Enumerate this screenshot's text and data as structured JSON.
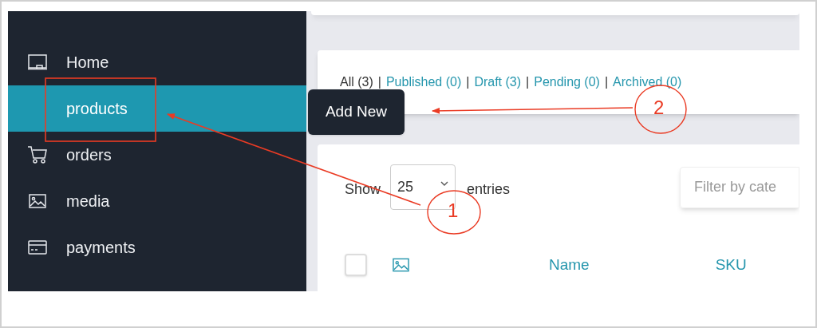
{
  "sidebar": {
    "items": [
      {
        "label": "Home",
        "selected": false
      },
      {
        "label": "products",
        "selected": true
      },
      {
        "label": "orders",
        "selected": false
      },
      {
        "label": "media",
        "selected": false
      },
      {
        "label": "payments",
        "selected": false
      }
    ]
  },
  "status_filters": {
    "separator": "|",
    "items": [
      {
        "label": "All (3)",
        "selected": true
      },
      {
        "label": "Published (0)",
        "selected": false
      },
      {
        "label": "Draft (3)",
        "selected": false
      },
      {
        "label": "Pending (0)",
        "selected": false
      },
      {
        "label": "Archived (0)",
        "selected": false
      }
    ]
  },
  "tooltip": {
    "text": "Add New"
  },
  "table": {
    "show_label": "Show",
    "page_size": "25",
    "entries_label": "entries",
    "filter_placeholder": "Filter by cate",
    "select_all_checked": false,
    "columns": [
      "Name",
      "SKU"
    ]
  },
  "annotations": [
    {
      "label": "1"
    },
    {
      "label": "2"
    }
  ]
}
